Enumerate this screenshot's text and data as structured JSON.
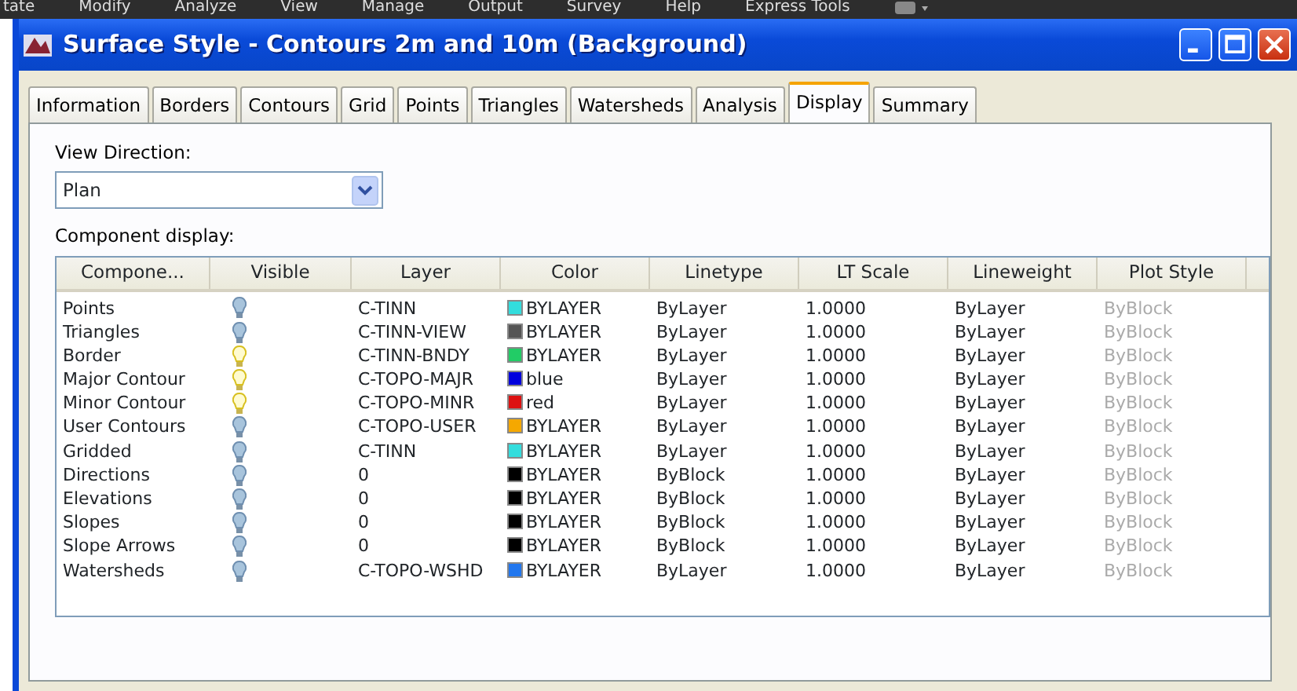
{
  "menu_bar": [
    "tate",
    "Modify",
    "Analyze",
    "View",
    "Manage",
    "Output",
    "Survey",
    "Help",
    "Express Tools"
  ],
  "window": {
    "title": "Surface Style - Contours 2m and 10m (Background)"
  },
  "tabs": [
    {
      "label": "Information",
      "selected": false
    },
    {
      "label": "Borders",
      "selected": false
    },
    {
      "label": "Contours",
      "selected": false
    },
    {
      "label": "Grid",
      "selected": false
    },
    {
      "label": "Points",
      "selected": false
    },
    {
      "label": "Triangles",
      "selected": false
    },
    {
      "label": "Watersheds",
      "selected": false
    },
    {
      "label": "Analysis",
      "selected": false
    },
    {
      "label": "Display",
      "selected": true
    },
    {
      "label": "Summary",
      "selected": false
    }
  ],
  "view_direction": {
    "label": "View Direction:",
    "value": "Plan"
  },
  "component_display": {
    "label": "Component display:",
    "columns": [
      "Compone...",
      "Visible",
      "Layer",
      "Color",
      "Linetype",
      "LT Scale",
      "Lineweight",
      "Plot Style"
    ],
    "rows": [
      {
        "component": "Points",
        "visible": false,
        "layer": "C-TINN",
        "color": "#33dddd",
        "color_name": "BYLAYER",
        "linetype": "ByLayer",
        "lt_scale": "1.0000",
        "lineweight": "ByLayer",
        "plot_style": "ByBlock",
        "plot_style_disabled": true
      },
      {
        "component": "Triangles",
        "visible": false,
        "layer": "C-TINN-VIEW",
        "color": "#555555",
        "color_name": "BYLAYER",
        "linetype": "ByLayer",
        "lt_scale": "1.0000",
        "lineweight": "ByLayer",
        "plot_style": "ByBlock",
        "plot_style_disabled": true
      },
      {
        "component": "Border",
        "visible": true,
        "layer": "C-TINN-BNDY",
        "color": "#22cc66",
        "color_name": "BYLAYER",
        "linetype": "ByLayer",
        "lt_scale": "1.0000",
        "lineweight": "ByLayer",
        "plot_style": "ByBlock",
        "plot_style_disabled": true
      },
      {
        "component": "Major Contour",
        "visible": true,
        "layer": "C-TOPO-MAJR",
        "color": "#0000dd",
        "color_name": "blue",
        "linetype": "ByLayer",
        "lt_scale": "1.0000",
        "lineweight": "ByLayer",
        "plot_style": "ByBlock",
        "plot_style_disabled": true
      },
      {
        "component": "Minor Contour",
        "visible": true,
        "layer": "C-TOPO-MINR",
        "color": "#dd1111",
        "color_name": "red",
        "linetype": "ByLayer",
        "lt_scale": "1.0000",
        "lineweight": "ByLayer",
        "plot_style": "ByBlock",
        "plot_style_disabled": true
      },
      {
        "component": "User Contours",
        "visible": false,
        "layer": "C-TOPO-USER",
        "color": "#f5a800",
        "color_name": "BYLAYER",
        "linetype": "ByLayer",
        "lt_scale": "1.0000",
        "lineweight": "ByLayer",
        "plot_style": "ByBlock",
        "plot_style_disabled": true
      },
      {
        "component": "Gridded",
        "visible": false,
        "layer": "C-TINN",
        "color": "#33dddd",
        "color_name": "BYLAYER",
        "linetype": "ByLayer",
        "lt_scale": "1.0000",
        "lineweight": "ByLayer",
        "plot_style": "ByBlock",
        "plot_style_disabled": true
      },
      {
        "component": "Directions",
        "visible": false,
        "layer": "0",
        "color": "#000000",
        "color_name": "BYLAYER",
        "linetype": "ByBlock",
        "lt_scale": "1.0000",
        "lineweight": "ByLayer",
        "plot_style": "ByBlock",
        "plot_style_disabled": true
      },
      {
        "component": "Elevations",
        "visible": false,
        "layer": "0",
        "color": "#000000",
        "color_name": "BYLAYER",
        "linetype": "ByBlock",
        "lt_scale": "1.0000",
        "lineweight": "ByLayer",
        "plot_style": "ByBlock",
        "plot_style_disabled": true
      },
      {
        "component": "Slopes",
        "visible": false,
        "layer": "0",
        "color": "#000000",
        "color_name": "BYLAYER",
        "linetype": "ByBlock",
        "lt_scale": "1.0000",
        "lineweight": "ByLayer",
        "plot_style": "ByBlock",
        "plot_style_disabled": true
      },
      {
        "component": "Slope Arrows",
        "visible": false,
        "layer": "0",
        "color": "#000000",
        "color_name": "BYLAYER",
        "linetype": "ByBlock",
        "lt_scale": "1.0000",
        "lineweight": "ByLayer",
        "plot_style": "ByBlock",
        "plot_style_disabled": true
      },
      {
        "component": "Watersheds",
        "visible": false,
        "layer": "C-TOPO-WSHD",
        "color": "#2277ee",
        "color_name": "BYLAYER",
        "linetype": "ByLayer",
        "lt_scale": "1.0000",
        "lineweight": "ByLayer",
        "plot_style": "ByBlock",
        "plot_style_disabled": true
      }
    ]
  }
}
